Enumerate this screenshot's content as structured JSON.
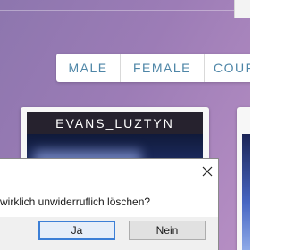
{
  "tabs": [
    {
      "label": "MALE"
    },
    {
      "label": "FEMALE"
    },
    {
      "label": "COUF"
    }
  ],
  "card": {
    "title": "EVANS_LUZTYN"
  },
  "dialog": {
    "message": "wirklich unwiderruflich löschen?",
    "close_icon": "close-icon",
    "yes_label": "Ja",
    "no_label": "Nein"
  },
  "colors": {
    "background": "#9c7cb6",
    "tab_text": "#4e86a7",
    "card_header": "#26222e",
    "default_button_border": "#3c7fd6"
  }
}
